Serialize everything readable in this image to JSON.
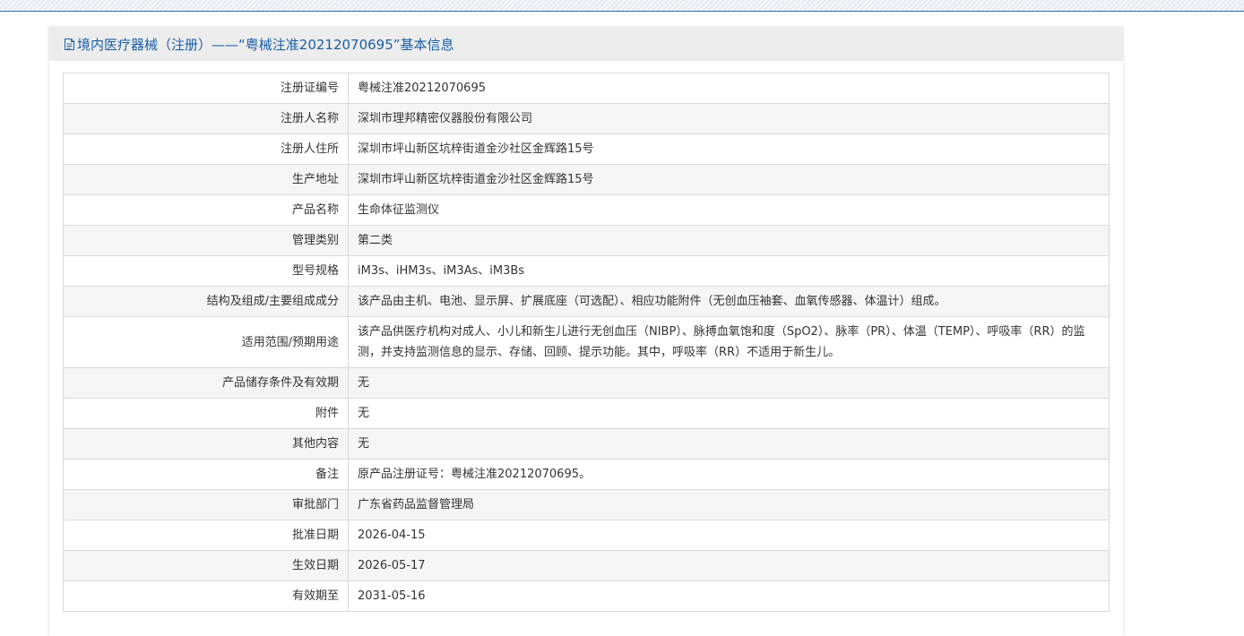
{
  "panel": {
    "title": "境内医疗器械（注册）——“粤械注准20212070695”基本信息",
    "title_icon": "document-icon",
    "accent_color": "#1a5fa8"
  },
  "rows": [
    {
      "label": "注册证编号",
      "value": "粤械注准20212070695"
    },
    {
      "label": "注册人名称",
      "value": "深圳市理邦精密仪器股份有限公司"
    },
    {
      "label": "注册人住所",
      "value": "深圳市坪山新区坑梓街道金沙社区金辉路15号"
    },
    {
      "label": "生产地址",
      "value": "深圳市坪山新区坑梓街道金沙社区金辉路15号"
    },
    {
      "label": "产品名称",
      "value": "生命体征监测仪"
    },
    {
      "label": "管理类别",
      "value": "第二类"
    },
    {
      "label": "型号规格",
      "value": "iM3s、iHM3s、iM3As、iM3Bs"
    },
    {
      "label": "结构及组成/主要组成成分",
      "value": "该产品由主机、电池、显示屏、扩展底座（可选配）、相应功能附件（无创血压袖套、血氧传感器、体温计）组成。"
    },
    {
      "label": "适用范围/预期用途",
      "value": "该产品供医疗机构对成人、小儿和新生儿进行无创血压（NIBP）、脉搏血氧饱和度（SpO2）、脉率（PR）、体温（TEMP）、呼吸率（RR）的监测，并支持监测信息的显示、存储、回顾、提示功能。其中，呼吸率（RR）不适用于新生儿。"
    },
    {
      "label": "产品储存条件及有效期",
      "value": "无"
    },
    {
      "label": "附件",
      "value": "无"
    },
    {
      "label": "其他内容",
      "value": "无"
    },
    {
      "label": "备注",
      "value": "原产品注册证号：粤械注准20212070695。"
    },
    {
      "label": "审批部门",
      "value": "广东省药品监督管理局"
    },
    {
      "label": "批准日期",
      "value": "2026-04-15"
    },
    {
      "label": "生效日期",
      "value": "2026-05-17"
    },
    {
      "label": "有效期至",
      "value": "2031-05-16"
    }
  ]
}
